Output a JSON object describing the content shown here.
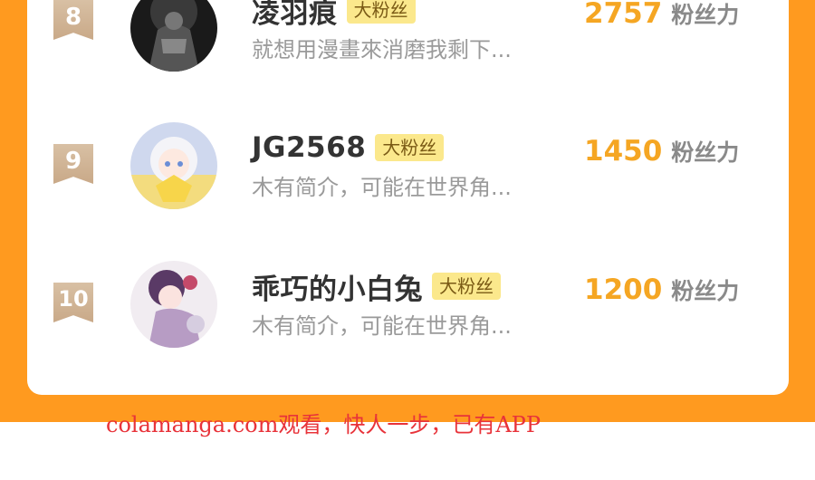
{
  "colors": {
    "background": "#ff9a1f",
    "card": "#ffffff",
    "score": "#f5a623",
    "tag_bg": "#fbe88c",
    "watermark": "#e8333a"
  },
  "rows": [
    {
      "rank": "8",
      "avatar_icon": "avatar-dark-figure",
      "name": "凌羽痕",
      "tag": "大粉丝",
      "bio": "就想用漫畫來消磨我剩下...",
      "score": "2757",
      "unit": "粉丝力"
    },
    {
      "rank": "9",
      "avatar_icon": "avatar-white-hair-girl",
      "name": "JG2568",
      "tag": "大粉丝",
      "bio": "木有简介，可能在世界角...",
      "score": "1450",
      "unit": "粉丝力"
    },
    {
      "rank": "10",
      "avatar_icon": "avatar-purple-anime",
      "name": "乖巧的小白兔",
      "tag": "大粉丝",
      "bio": "木有简介，可能在世界角...",
      "score": "1200",
      "unit": "粉丝力"
    }
  ],
  "watermark": "colamanga.com观看，快人一步，已有APP"
}
